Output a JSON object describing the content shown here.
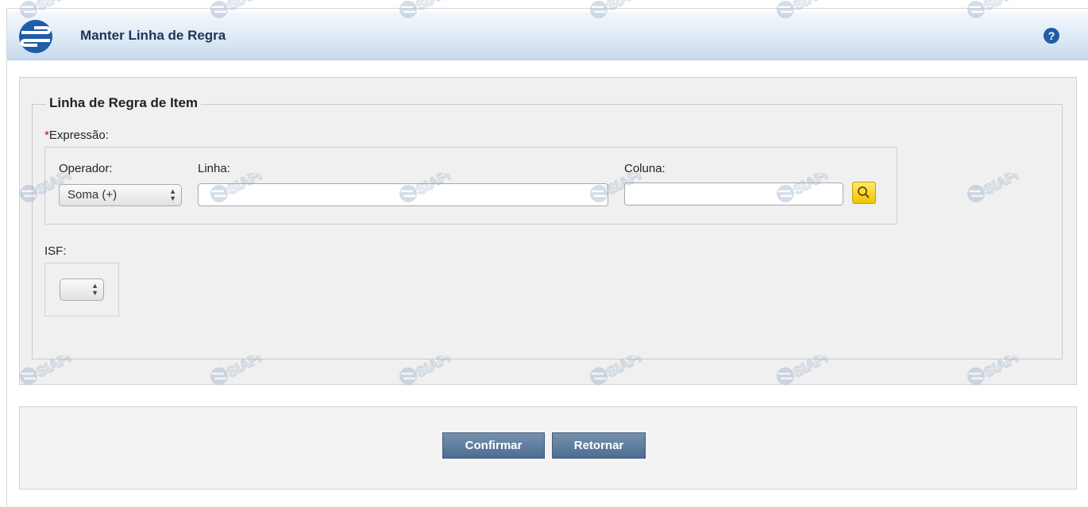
{
  "header": {
    "title": "Manter Linha de Regra",
    "help_icon": "?"
  },
  "fieldset": {
    "legend": "Linha de Regra de Item"
  },
  "expressao": {
    "required_marker": "*",
    "label": "Expressão:",
    "operador": {
      "label": "Operador:",
      "selected": "Soma (+)"
    },
    "linha": {
      "label": "Linha:",
      "value": ""
    },
    "coluna": {
      "label": "Coluna:",
      "value": ""
    }
  },
  "isf": {
    "label": "ISF:",
    "selected": ""
  },
  "buttons": {
    "confirmar": "Confirmar",
    "retornar": "Retornar"
  },
  "watermark": {
    "text": "SIAFI"
  },
  "colors": {
    "header_text": "#1d3557",
    "button_bg": "#5b7a9e",
    "search_button_bg": "#f5d000",
    "required": "#d20000"
  }
}
